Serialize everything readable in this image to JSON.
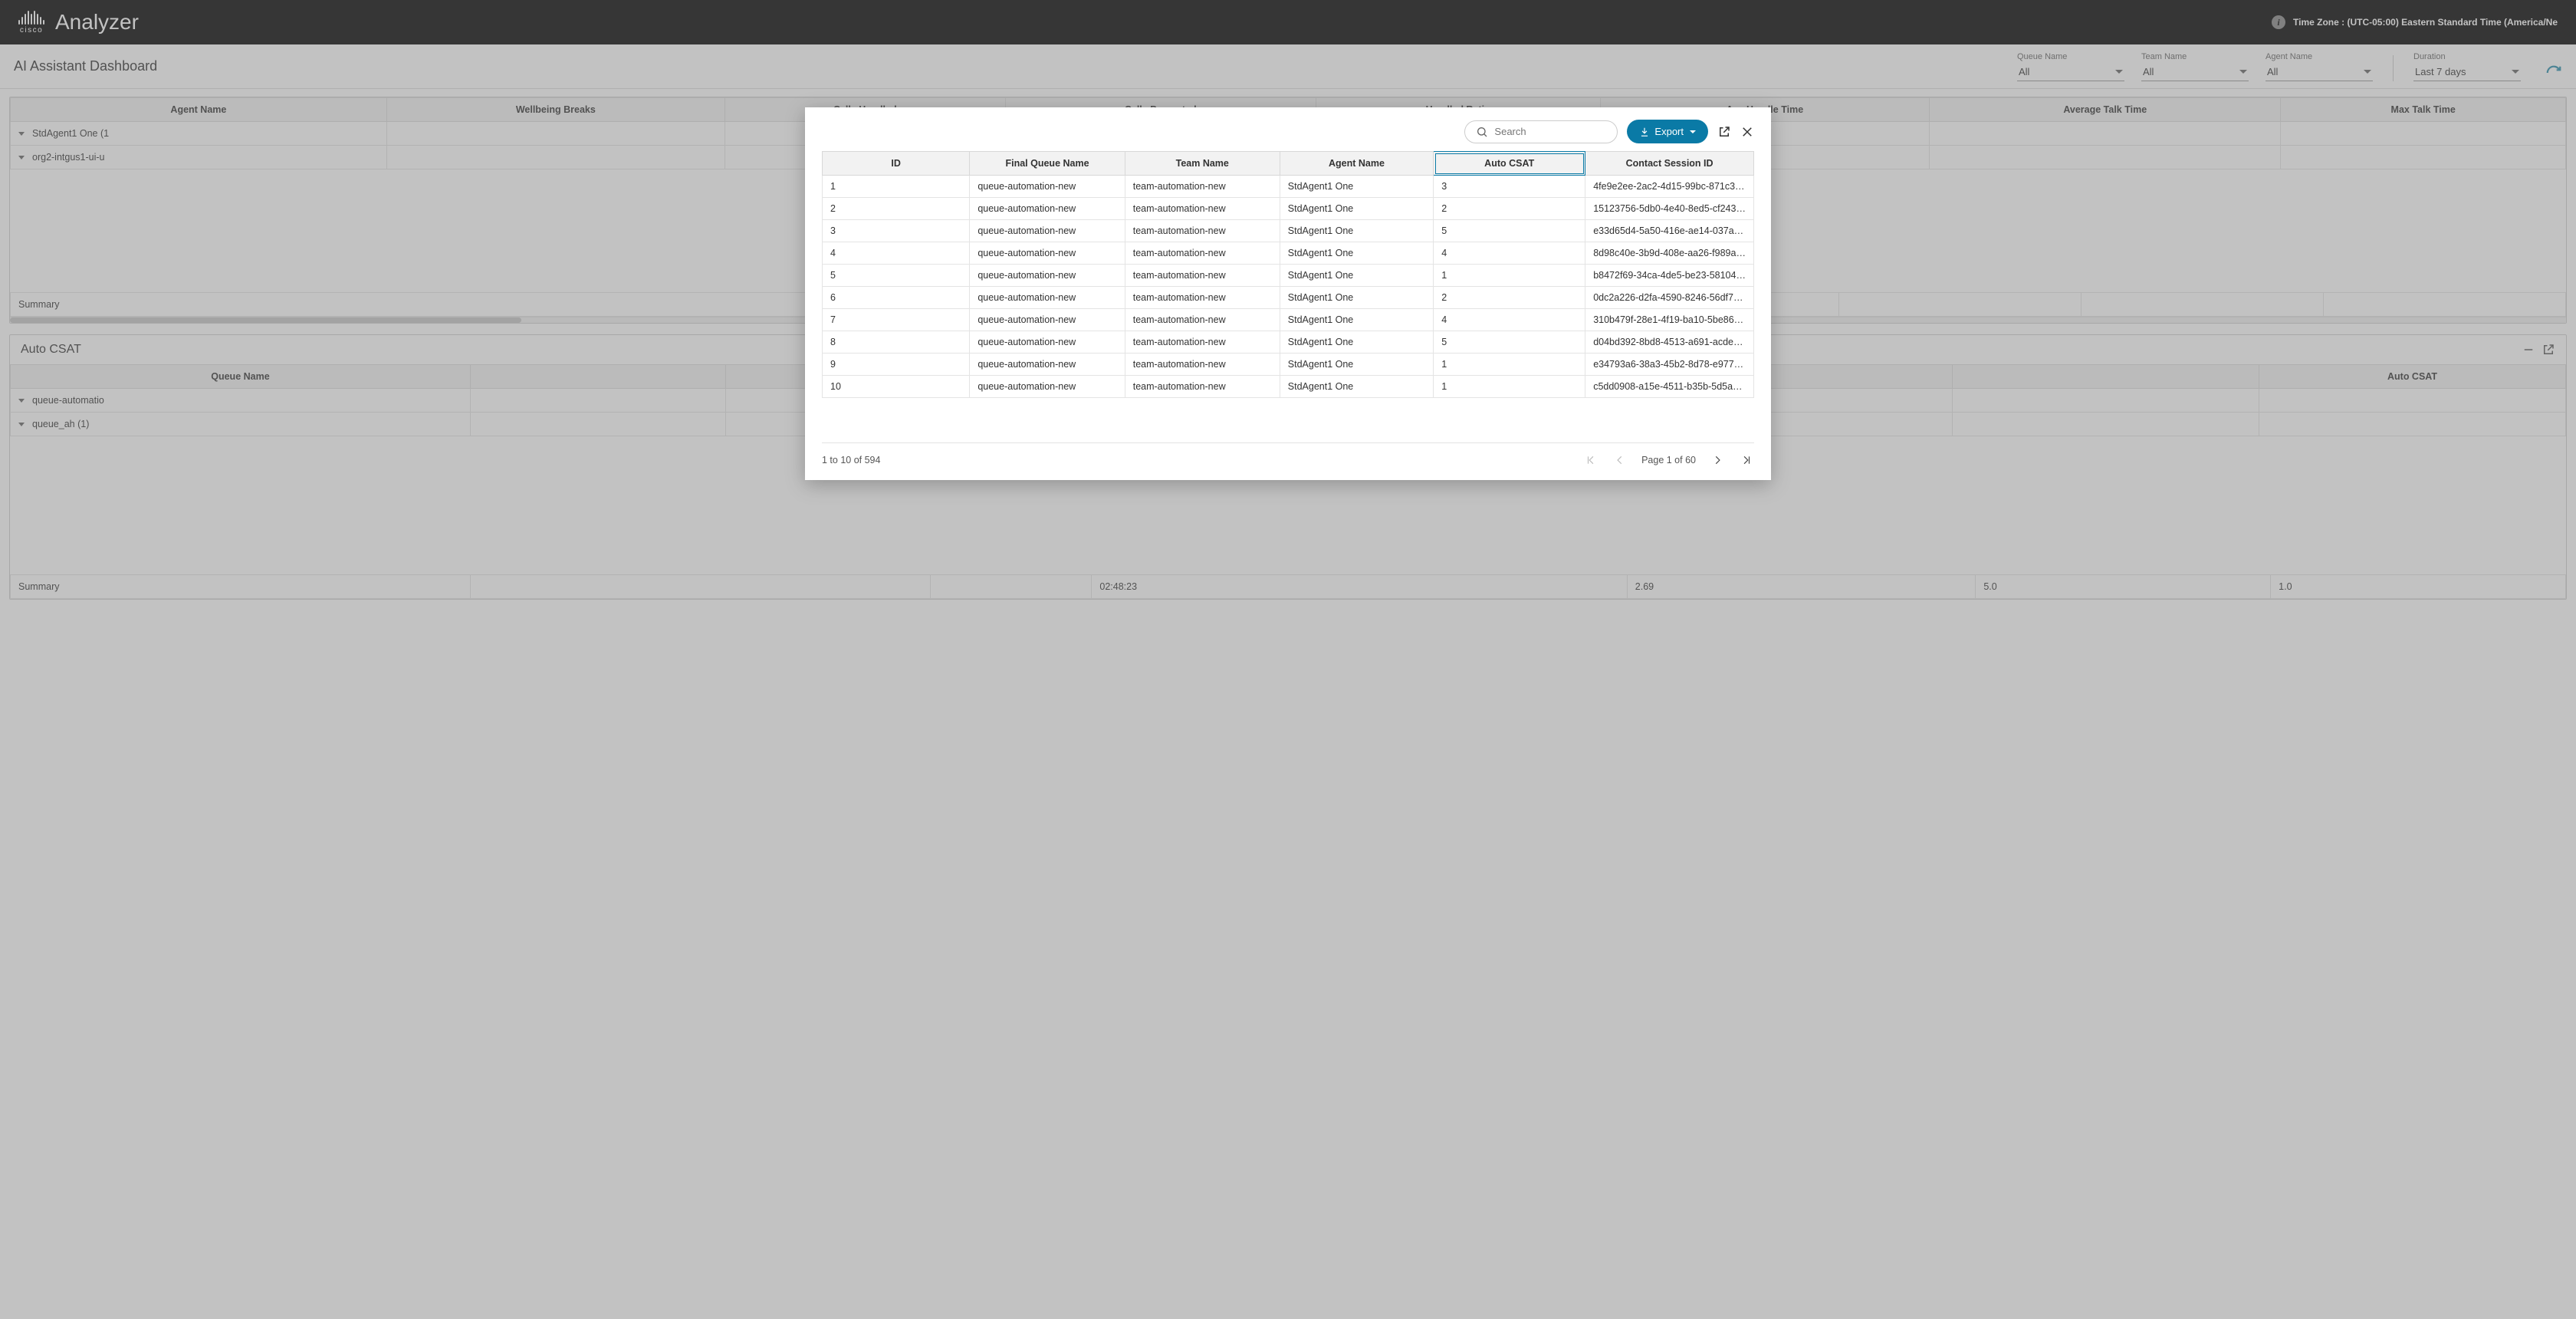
{
  "header": {
    "brand_sub": "cisco",
    "app_name": "Analyzer",
    "tz_label": "Time Zone : (UTC-05:00) Eastern Standard Time (America/Ne"
  },
  "filterbar": {
    "title": "AI Assistant Dashboard",
    "filters": [
      {
        "label": "Queue Name",
        "value": "All"
      },
      {
        "label": "Team Name",
        "value": "All"
      },
      {
        "label": "Agent Name",
        "value": "All"
      },
      {
        "label": "Duration",
        "value": "Last 7 days"
      }
    ]
  },
  "panel1": {
    "cols": [
      "Agent Name",
      "Wellbeing Breaks",
      "Calls Handled",
      "Calls Presented",
      "Handled Ratio",
      "Avg Handle Time",
      "Average Talk Time",
      "Max Talk Time"
    ],
    "rows": [
      {
        "name": "StdAgent1 One (1"
      },
      {
        "name": "org2-intgus1-ui-u"
      }
    ],
    "summary": "Summary"
  },
  "panel2": {
    "title": "Auto CSAT",
    "cols": [
      "Queue Name",
      "Auto CSAT"
    ],
    "rows": [
      {
        "name": "queue-automatio"
      },
      {
        "name": "queue_ah (1)"
      }
    ],
    "summary": "Summary",
    "sum_vals": [
      "",
      "02:48:23",
      "2.69",
      "5.0",
      "1.0"
    ]
  },
  "modal": {
    "search_placeholder": "Search",
    "export_label": "Export",
    "cols": [
      "ID",
      "Final Queue Name",
      "Team Name",
      "Agent Name",
      "Auto CSAT",
      "Contact Session ID"
    ],
    "rows": [
      {
        "id": "1",
        "queue": "queue-automation-new",
        "team": "team-automation-new",
        "agent": "StdAgent1 One",
        "csat": "3",
        "session": "4fe9e2ee-2ac2-4d15-99bc-871c3…"
      },
      {
        "id": "2",
        "queue": "queue-automation-new",
        "team": "team-automation-new",
        "agent": "StdAgent1 One",
        "csat": "2",
        "session": "15123756-5db0-4e40-8ed5-cf243…"
      },
      {
        "id": "3",
        "queue": "queue-automation-new",
        "team": "team-automation-new",
        "agent": "StdAgent1 One",
        "csat": "5",
        "session": "e33d65d4-5a50-416e-ae14-037a…"
      },
      {
        "id": "4",
        "queue": "queue-automation-new",
        "team": "team-automation-new",
        "agent": "StdAgent1 One",
        "csat": "4",
        "session": "8d98c40e-3b9d-408e-aa26-f989a…"
      },
      {
        "id": "5",
        "queue": "queue-automation-new",
        "team": "team-automation-new",
        "agent": "StdAgent1 One",
        "csat": "1",
        "session": "b8472f69-34ca-4de5-be23-58104…"
      },
      {
        "id": "6",
        "queue": "queue-automation-new",
        "team": "team-automation-new",
        "agent": "StdAgent1 One",
        "csat": "2",
        "session": "0dc2a226-d2fa-4590-8246-56df7…"
      },
      {
        "id": "7",
        "queue": "queue-automation-new",
        "team": "team-automation-new",
        "agent": "StdAgent1 One",
        "csat": "4",
        "session": "310b479f-28e1-4f19-ba10-5be86…"
      },
      {
        "id": "8",
        "queue": "queue-automation-new",
        "team": "team-automation-new",
        "agent": "StdAgent1 One",
        "csat": "5",
        "session": "d04bd392-8bd8-4513-a691-acde…"
      },
      {
        "id": "9",
        "queue": "queue-automation-new",
        "team": "team-automation-new",
        "agent": "StdAgent1 One",
        "csat": "1",
        "session": "e34793a6-38a3-45b2-8d78-e977…"
      },
      {
        "id": "10",
        "queue": "queue-automation-new",
        "team": "team-automation-new",
        "agent": "StdAgent1 One",
        "csat": "1",
        "session": "c5dd0908-a15e-4511-b35b-5d5a…"
      }
    ],
    "range": "1 to 10 of 594",
    "page": "Page 1 of 60"
  }
}
